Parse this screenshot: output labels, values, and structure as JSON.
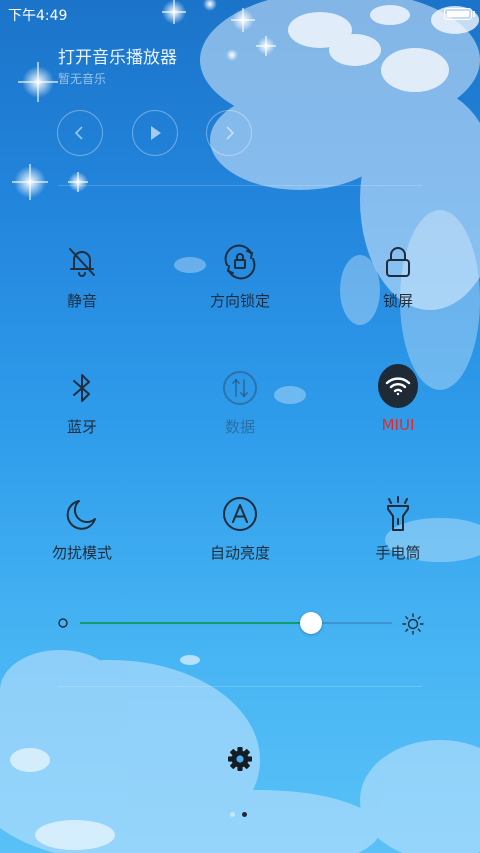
{
  "status_bar": {
    "time": "下午4:49",
    "battery_icon": "battery-icon"
  },
  "music": {
    "title": "打开音乐播放器",
    "subtitle": "暂无音乐",
    "controls": [
      "previous-icon",
      "play-icon",
      "next-icon"
    ]
  },
  "toggles": [
    {
      "label": "静音",
      "icon": "bell-off-icon",
      "state": "off"
    },
    {
      "label": "方向锁定",
      "icon": "rotation-lock-icon",
      "state": "off"
    },
    {
      "label": "锁屏",
      "icon": "lock-icon",
      "state": "off"
    },
    {
      "label": "蓝牙",
      "icon": "bluetooth-icon",
      "state": "off"
    },
    {
      "label": "数据",
      "icon": "mobile-data-icon",
      "state": "disabled"
    },
    {
      "label": "MIUI",
      "icon": "wifi-icon",
      "state": "on"
    },
    {
      "label": "勿扰模式",
      "icon": "moon-icon",
      "state": "off"
    },
    {
      "label": "自动亮度",
      "icon": "auto-brightness-icon",
      "state": "off"
    },
    {
      "label": "手电筒",
      "icon": "flashlight-icon",
      "state": "off"
    }
  ],
  "brightness": {
    "level_percent": 74,
    "min_icon": "dim-icon",
    "max_icon": "sun-icon"
  },
  "settings_icon": "gear-icon",
  "pager": {
    "pages": 2,
    "current": 2
  },
  "colors": {
    "background_top": "#1b74c9",
    "background_bottom": "#59c1f7",
    "icon": "#1f2d3d",
    "active_label": "#e02b2b",
    "slider_fill": "#0e9e6a"
  }
}
